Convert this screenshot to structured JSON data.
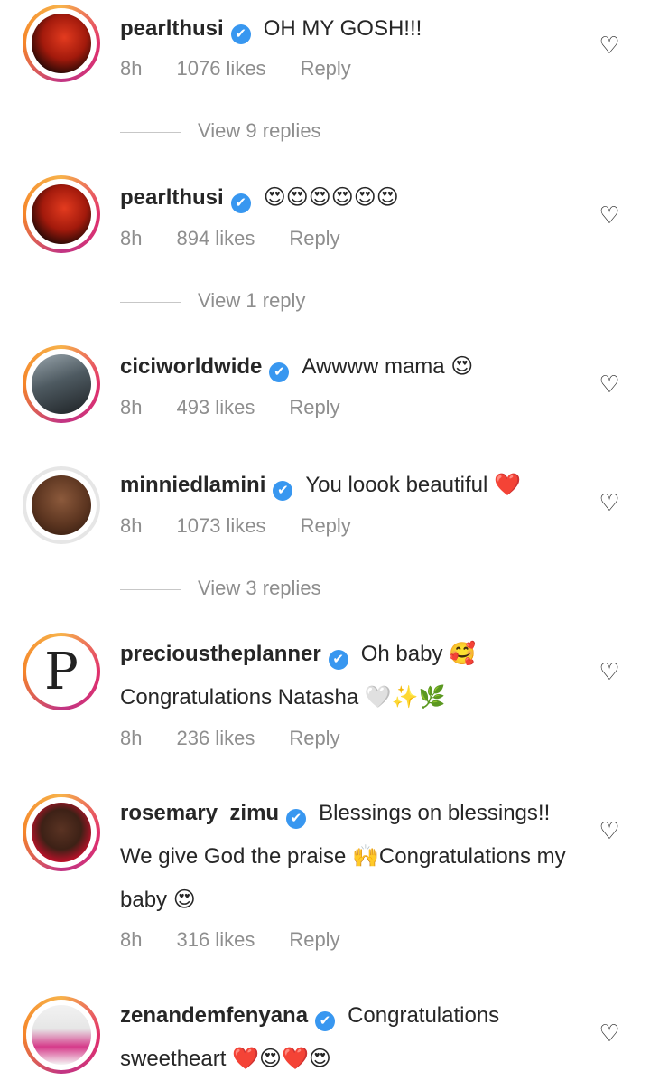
{
  "comments": [
    {
      "username": "pearlthusi",
      "text": "OH MY GOSH!!!",
      "time": "8h",
      "likes": "1076 likes",
      "reply": "Reply",
      "view_replies": "View 9 replies"
    },
    {
      "username": "pearlthusi",
      "text": "😍😍😍😍😍😍",
      "time": "8h",
      "likes": "894 likes",
      "reply": "Reply",
      "view_replies": "View 1 reply"
    },
    {
      "username": "ciciworldwide",
      "text": "Awwww mama 😍",
      "time": "8h",
      "likes": "493 likes",
      "reply": "Reply"
    },
    {
      "username": "minniedlamini",
      "text": "You loook beautiful ❤️",
      "time": "8h",
      "likes": "1073 likes",
      "reply": "Reply",
      "view_replies": "View 3 replies"
    },
    {
      "username": "precioustheplanner",
      "text": "Oh baby 🥰 Congratulations Natasha 🤍✨🌿",
      "avatar_letter": "P",
      "time": "8h",
      "likes": "236 likes",
      "reply": "Reply"
    },
    {
      "username": "rosemary_zimu",
      "text": "Blessings on blessings!! We give God the praise 🙌Congratulations my baby 😍",
      "time": "8h",
      "likes": "316 likes",
      "reply": "Reply"
    },
    {
      "username": "zenandemfenyana",
      "text": "Congratulations sweetheart ❤️😍❤️😍"
    }
  ],
  "icons": {
    "verified": "✔",
    "like": "♡"
  },
  "colors": {
    "verified": "#3897f0",
    "meta_text": "#8e8e8e",
    "text": "#262626"
  }
}
